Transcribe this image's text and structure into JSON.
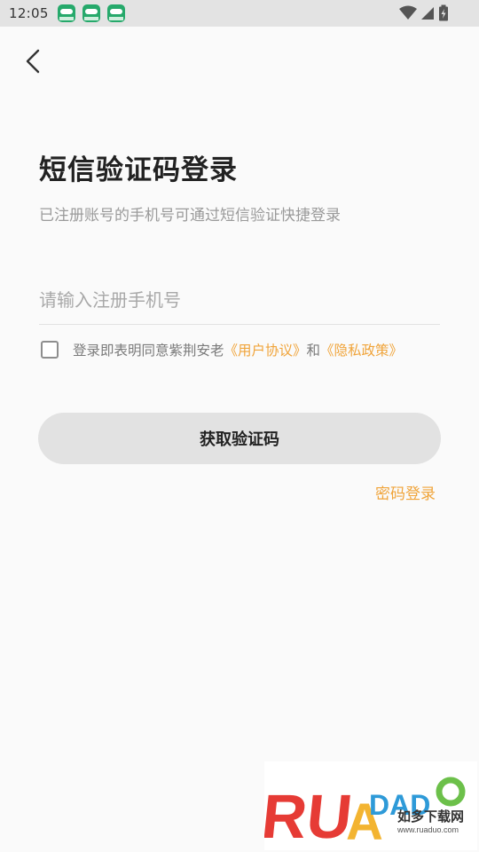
{
  "status_bar": {
    "time": "12:05",
    "notification_icons": [
      "app-notification-icon",
      "app-notification-icon",
      "app-notification-icon"
    ],
    "system_icons": [
      "wifi-icon",
      "signal-icon",
      "battery-icon"
    ]
  },
  "header": {
    "back_icon": "chevron-left-icon"
  },
  "login": {
    "title": "短信验证码登录",
    "subtitle": "已注册账号的手机号可通过短信验证快捷登录",
    "phone_placeholder": "请输入注册手机号",
    "phone_value": "",
    "agreement": {
      "checked": false,
      "prefix": "登录即表明同意紫荆安老",
      "user_agreement": "《用户协议》",
      "conjunction": "和",
      "privacy_policy": "《隐私政策》"
    },
    "get_code_button": "获取验证码",
    "password_login_link": "密码登录"
  },
  "watermark": {
    "logo_text": "RUANDADUO",
    "cn_text": "如多下载网",
    "url": "www.ruaduo.com"
  },
  "colors": {
    "accent": "#f0a43a",
    "button_bg": "#e2e2e2",
    "page_bg": "#fafafa",
    "status_bar_bg": "#e3e3e3"
  }
}
